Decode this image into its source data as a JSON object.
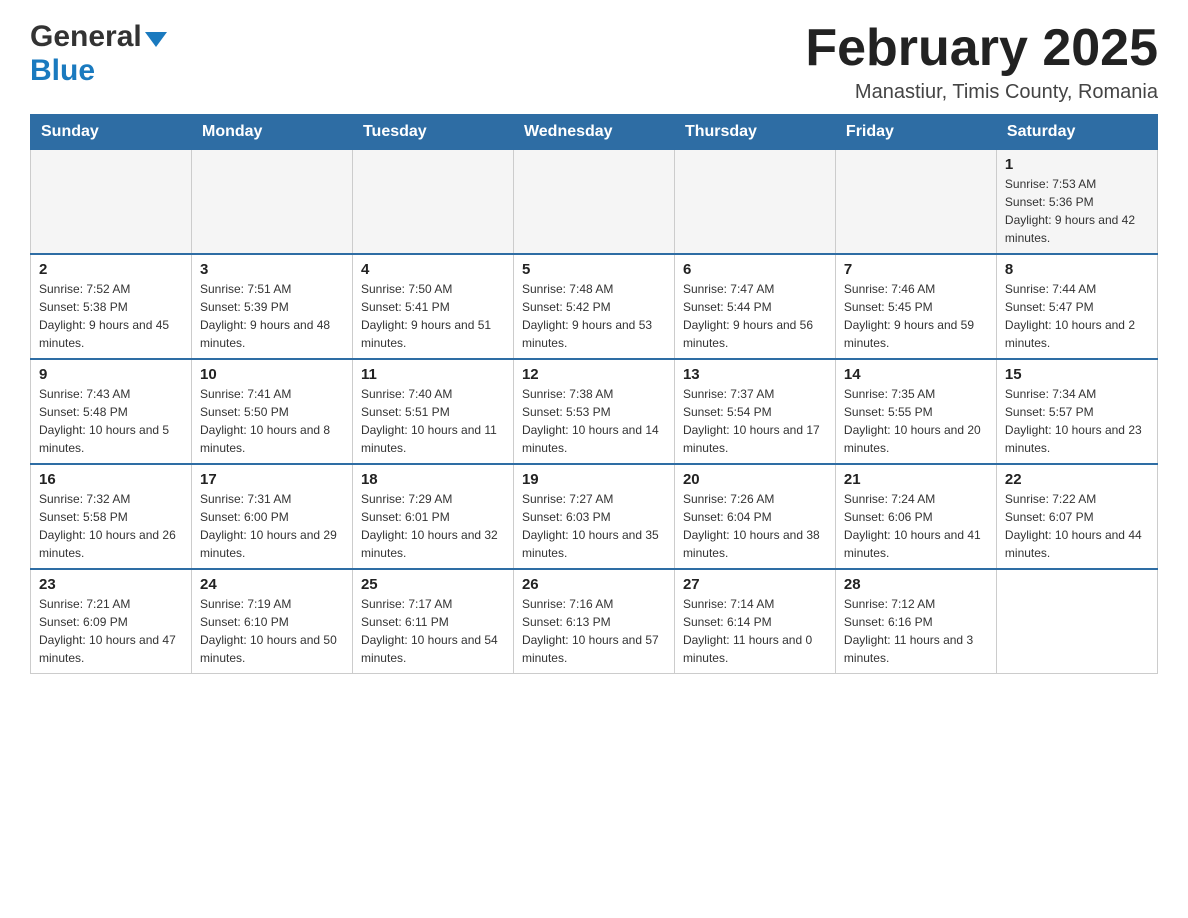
{
  "header": {
    "logo_general": "General",
    "logo_blue": "Blue",
    "title": "February 2025",
    "subtitle": "Manastiur, Timis County, Romania"
  },
  "days_of_week": [
    "Sunday",
    "Monday",
    "Tuesday",
    "Wednesday",
    "Thursday",
    "Friday",
    "Saturday"
  ],
  "weeks": [
    {
      "days": [
        {
          "num": "",
          "info": ""
        },
        {
          "num": "",
          "info": ""
        },
        {
          "num": "",
          "info": ""
        },
        {
          "num": "",
          "info": ""
        },
        {
          "num": "",
          "info": ""
        },
        {
          "num": "",
          "info": ""
        },
        {
          "num": "1",
          "info": "Sunrise: 7:53 AM\nSunset: 5:36 PM\nDaylight: 9 hours and 42 minutes."
        }
      ]
    },
    {
      "days": [
        {
          "num": "2",
          "info": "Sunrise: 7:52 AM\nSunset: 5:38 PM\nDaylight: 9 hours and 45 minutes."
        },
        {
          "num": "3",
          "info": "Sunrise: 7:51 AM\nSunset: 5:39 PM\nDaylight: 9 hours and 48 minutes."
        },
        {
          "num": "4",
          "info": "Sunrise: 7:50 AM\nSunset: 5:41 PM\nDaylight: 9 hours and 51 minutes."
        },
        {
          "num": "5",
          "info": "Sunrise: 7:48 AM\nSunset: 5:42 PM\nDaylight: 9 hours and 53 minutes."
        },
        {
          "num": "6",
          "info": "Sunrise: 7:47 AM\nSunset: 5:44 PM\nDaylight: 9 hours and 56 minutes."
        },
        {
          "num": "7",
          "info": "Sunrise: 7:46 AM\nSunset: 5:45 PM\nDaylight: 9 hours and 59 minutes."
        },
        {
          "num": "8",
          "info": "Sunrise: 7:44 AM\nSunset: 5:47 PM\nDaylight: 10 hours and 2 minutes."
        }
      ]
    },
    {
      "days": [
        {
          "num": "9",
          "info": "Sunrise: 7:43 AM\nSunset: 5:48 PM\nDaylight: 10 hours and 5 minutes."
        },
        {
          "num": "10",
          "info": "Sunrise: 7:41 AM\nSunset: 5:50 PM\nDaylight: 10 hours and 8 minutes."
        },
        {
          "num": "11",
          "info": "Sunrise: 7:40 AM\nSunset: 5:51 PM\nDaylight: 10 hours and 11 minutes."
        },
        {
          "num": "12",
          "info": "Sunrise: 7:38 AM\nSunset: 5:53 PM\nDaylight: 10 hours and 14 minutes."
        },
        {
          "num": "13",
          "info": "Sunrise: 7:37 AM\nSunset: 5:54 PM\nDaylight: 10 hours and 17 minutes."
        },
        {
          "num": "14",
          "info": "Sunrise: 7:35 AM\nSunset: 5:55 PM\nDaylight: 10 hours and 20 minutes."
        },
        {
          "num": "15",
          "info": "Sunrise: 7:34 AM\nSunset: 5:57 PM\nDaylight: 10 hours and 23 minutes."
        }
      ]
    },
    {
      "days": [
        {
          "num": "16",
          "info": "Sunrise: 7:32 AM\nSunset: 5:58 PM\nDaylight: 10 hours and 26 minutes."
        },
        {
          "num": "17",
          "info": "Sunrise: 7:31 AM\nSunset: 6:00 PM\nDaylight: 10 hours and 29 minutes."
        },
        {
          "num": "18",
          "info": "Sunrise: 7:29 AM\nSunset: 6:01 PM\nDaylight: 10 hours and 32 minutes."
        },
        {
          "num": "19",
          "info": "Sunrise: 7:27 AM\nSunset: 6:03 PM\nDaylight: 10 hours and 35 minutes."
        },
        {
          "num": "20",
          "info": "Sunrise: 7:26 AM\nSunset: 6:04 PM\nDaylight: 10 hours and 38 minutes."
        },
        {
          "num": "21",
          "info": "Sunrise: 7:24 AM\nSunset: 6:06 PM\nDaylight: 10 hours and 41 minutes."
        },
        {
          "num": "22",
          "info": "Sunrise: 7:22 AM\nSunset: 6:07 PM\nDaylight: 10 hours and 44 minutes."
        }
      ]
    },
    {
      "days": [
        {
          "num": "23",
          "info": "Sunrise: 7:21 AM\nSunset: 6:09 PM\nDaylight: 10 hours and 47 minutes."
        },
        {
          "num": "24",
          "info": "Sunrise: 7:19 AM\nSunset: 6:10 PM\nDaylight: 10 hours and 50 minutes."
        },
        {
          "num": "25",
          "info": "Sunrise: 7:17 AM\nSunset: 6:11 PM\nDaylight: 10 hours and 54 minutes."
        },
        {
          "num": "26",
          "info": "Sunrise: 7:16 AM\nSunset: 6:13 PM\nDaylight: 10 hours and 57 minutes."
        },
        {
          "num": "27",
          "info": "Sunrise: 7:14 AM\nSunset: 6:14 PM\nDaylight: 11 hours and 0 minutes."
        },
        {
          "num": "28",
          "info": "Sunrise: 7:12 AM\nSunset: 6:16 PM\nDaylight: 11 hours and 3 minutes."
        },
        {
          "num": "",
          "info": ""
        }
      ]
    }
  ]
}
